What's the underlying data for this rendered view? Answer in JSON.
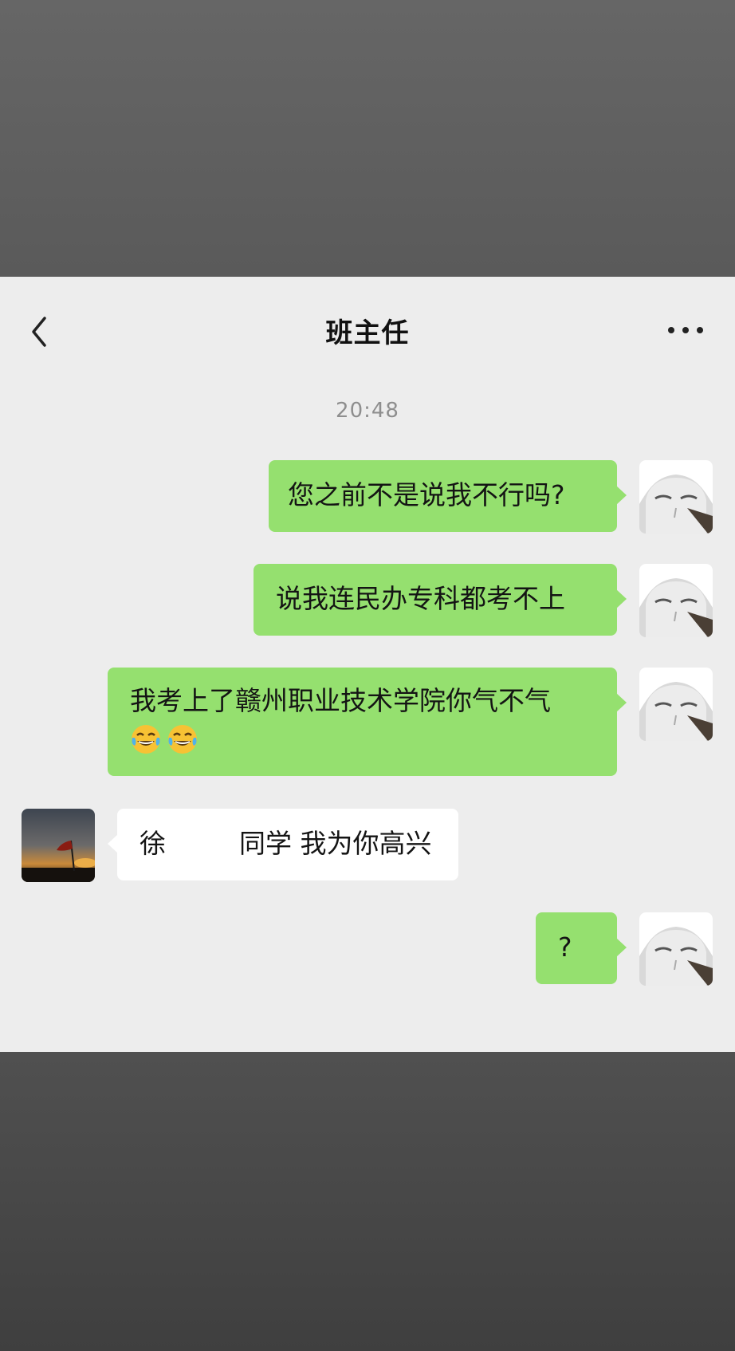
{
  "chat": {
    "title": "班主任",
    "timestamp": "20:48",
    "messages": [
      {
        "from": "me",
        "text": "您之前不是说我不行吗?"
      },
      {
        "from": "me",
        "text": "说我连民办专科都考不上"
      },
      {
        "from": "me",
        "text": "我考上了赣州职业技术学院你气不气",
        "emoji": [
          "joy-tears-emoji",
          "joy-tears-emoji"
        ]
      },
      {
        "from": "teacher",
        "name_part": "徐",
        "text": "同学 我为你高兴"
      },
      {
        "from": "me",
        "text": "?"
      }
    ]
  },
  "colors": {
    "outgoing_bubble": "#95e06f",
    "incoming_bubble": "#ffffff",
    "chat_background": "#ededed"
  },
  "icons": [
    "back-arrow-icon",
    "more-options-icon"
  ]
}
